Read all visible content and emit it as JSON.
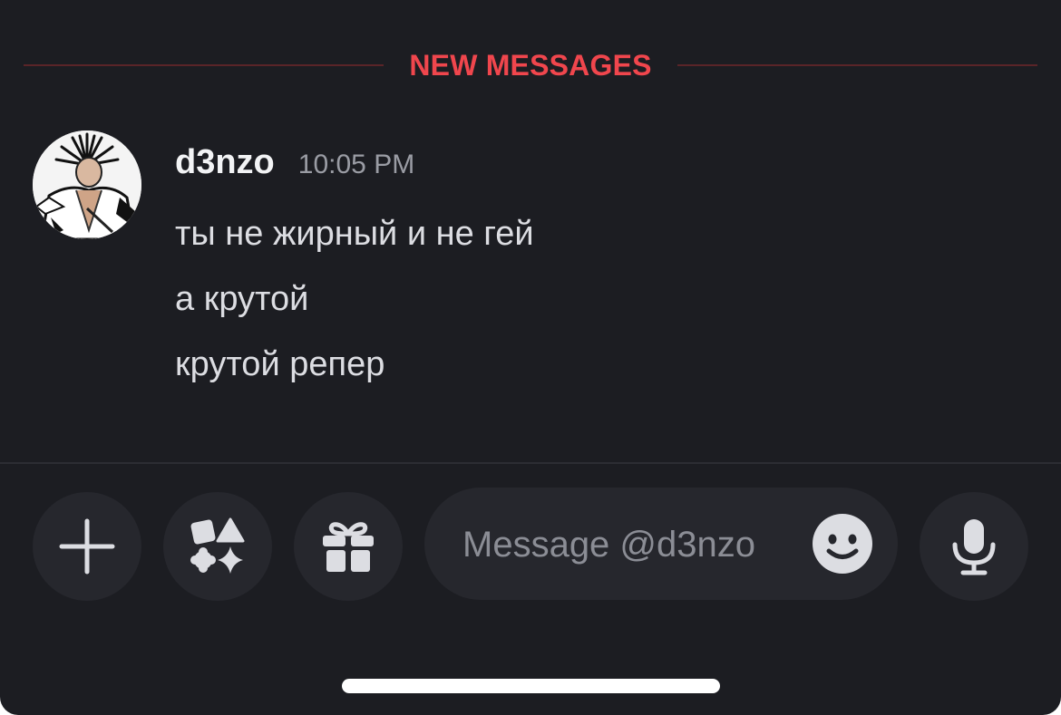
{
  "divider": {
    "label": "NEW MESSAGES"
  },
  "message": {
    "username": "d3nzo",
    "timestamp": "10:05 PM",
    "lines": [
      "ты не жирный и не гей",
      "а крутой",
      "крутой репер"
    ]
  },
  "composer": {
    "placeholder": "Message @d3nzo",
    "buttons": {
      "add": "plus-icon",
      "apps": "apps-icon",
      "gift": "gift-icon",
      "emoji": "emoji-icon",
      "voice": "microphone-icon"
    }
  },
  "colors": {
    "background": "#1c1d22",
    "new_messages_accent": "#f0464d",
    "button_bg": "#26272d"
  }
}
